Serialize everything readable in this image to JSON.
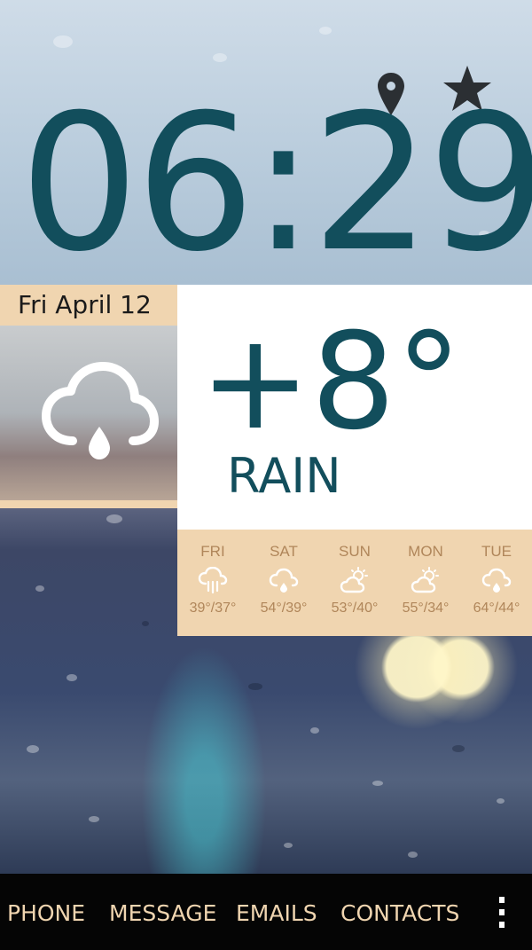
{
  "clock": {
    "time": "06:29"
  },
  "date": {
    "label": "Fri April 12"
  },
  "current": {
    "temperature": "+8°",
    "condition": "RAIN",
    "icon": "cloud-rain-icon"
  },
  "header_icons": [
    "location-pin-icon",
    "star-icon"
  ],
  "forecast": [
    {
      "day": "FRI",
      "icon": "cloud-heavy-rain-icon",
      "temps": "39°/37°"
    },
    {
      "day": "SAT",
      "icon": "cloud-rain-icon",
      "temps": "54°/39°"
    },
    {
      "day": "SUN",
      "icon": "sun-cloud-icon",
      "temps": "53°/40°"
    },
    {
      "day": "MON",
      "icon": "sun-cloud-icon",
      "temps": "55°/34°"
    },
    {
      "day": "TUE",
      "icon": "cloud-rain-icon",
      "temps": "64°/44°"
    }
  ],
  "nav": {
    "phone": "PHONE",
    "message": "MESSAGE",
    "emails": "EMAILS",
    "contacts": "CONTACTS",
    "menu_icon": "overflow-menu-icon"
  },
  "colors": {
    "accent": "#124e5c",
    "panel": "#f0d5b0",
    "forecast_text": "#b0865a",
    "navbar_bg": "#050505"
  }
}
